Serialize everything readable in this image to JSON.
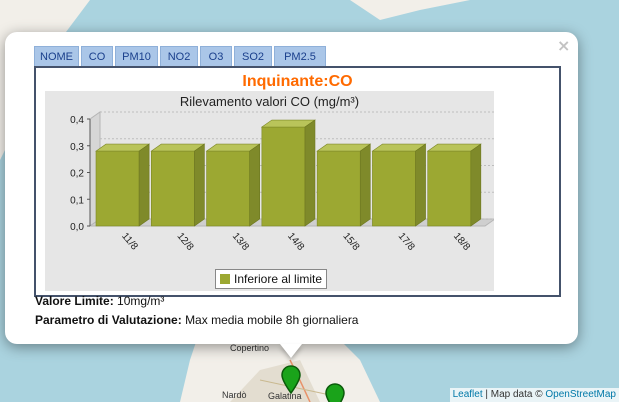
{
  "map": {
    "towns": [
      "Copertino",
      "Nardò",
      "Galatina"
    ],
    "attribution": {
      "leaflet": "Leaflet",
      "separator": " | Map data © ",
      "osm": "OpenStreetMap"
    },
    "colors": {
      "sea": "#aad3df",
      "land": "#f2efe9",
      "marker": "#1aa31a"
    }
  },
  "popup": {
    "close": "×",
    "tabs": [
      "NOME",
      "CO",
      "PM10",
      "NO2",
      "O3",
      "SO2",
      "PM2.5"
    ],
    "heading": "Inquinante:CO",
    "info": {
      "limit_label": "Valore Limite:",
      "limit_value": "10mg/m³",
      "param_label": "Parametro di Valutazione:",
      "param_value": "Max media mobile 8h giornaliera"
    }
  },
  "chart_data": {
    "type": "bar",
    "title": "Rilevamento valori CO (mg/m³)",
    "categories": [
      "11/8",
      "12/8",
      "13/8",
      "14/8",
      "15/8",
      "17/8",
      "18/8"
    ],
    "series": [
      {
        "name": "Inferiore al limite",
        "values": [
          0.28,
          0.28,
          0.28,
          0.37,
          0.28,
          0.28,
          0.28
        ],
        "color": "#9ca832"
      }
    ],
    "ylim": [
      0,
      0.4
    ],
    "yticks": [
      "0,0",
      "0,1",
      "0,2",
      "0,3",
      "0,4"
    ],
    "grid": true,
    "legend": "bottom"
  }
}
